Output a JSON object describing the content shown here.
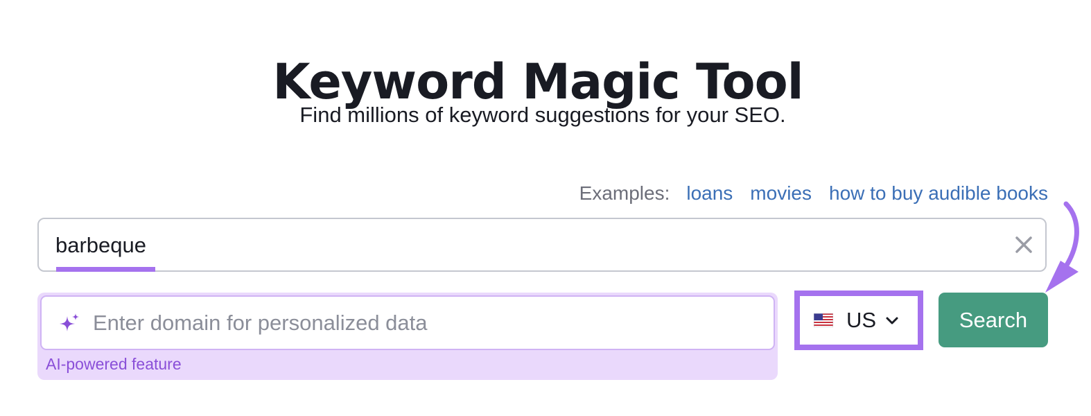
{
  "header": {
    "title": "Keyword Magic Tool",
    "subtitle": "Find millions of keyword suggestions for your SEO."
  },
  "examples": {
    "label": "Examples:",
    "links": [
      "loans",
      "movies",
      "how to buy audible books"
    ]
  },
  "keyword_input": {
    "value": "barbeque",
    "clear_icon": "close-icon"
  },
  "domain_input": {
    "placeholder": "Enter domain for personalized data",
    "icon": "sparkle-icon",
    "feature_label": "AI-powered feature"
  },
  "database_select": {
    "selected": "US",
    "flag_icon": "us-flag-icon",
    "chevron_icon": "chevron-down-icon"
  },
  "search_button": {
    "label": "Search"
  },
  "colors": {
    "accent_purple": "#a572ee",
    "search_green": "#469b80",
    "link_blue": "#3b6fb6",
    "ai_panel_bg": "#ead9fc"
  }
}
